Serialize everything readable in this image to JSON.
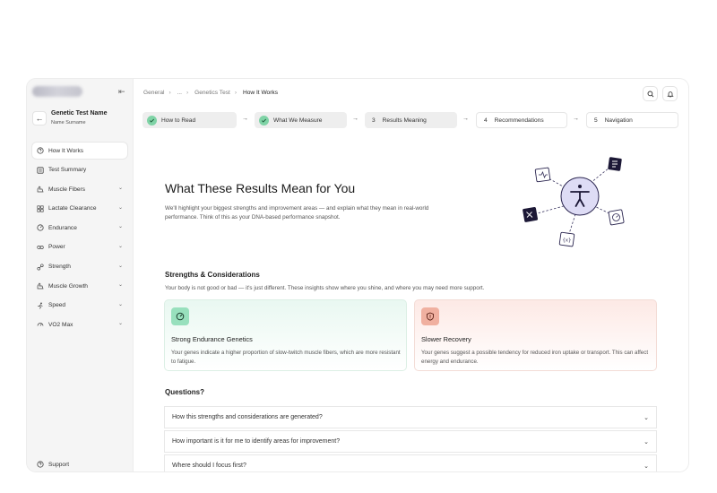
{
  "sidebar": {
    "user": {
      "name": "Genetic Test Name",
      "subtitle": "Name Surname"
    },
    "items": [
      {
        "label": "How It Works",
        "icon": "book-icon",
        "active": true,
        "expandable": false
      },
      {
        "label": "Test Summary",
        "icon": "summary-icon",
        "active": false,
        "expandable": false
      },
      {
        "label": "Muscle Fibers",
        "icon": "muscle-icon",
        "active": false,
        "expandable": true
      },
      {
        "label": "Lactate Clearance",
        "icon": "lactate-icon",
        "active": false,
        "expandable": true
      },
      {
        "label": "Endurance",
        "icon": "endurance-icon",
        "active": false,
        "expandable": true
      },
      {
        "label": "Power",
        "icon": "power-icon",
        "active": false,
        "expandable": true
      },
      {
        "label": "Strength",
        "icon": "strength-icon",
        "active": false,
        "expandable": true
      },
      {
        "label": "Muscle Growth",
        "icon": "growth-icon",
        "active": false,
        "expandable": true
      },
      {
        "label": "Speed",
        "icon": "speed-icon",
        "active": false,
        "expandable": true
      },
      {
        "label": "VO2 Max",
        "icon": "vo2-icon",
        "active": false,
        "expandable": true
      }
    ],
    "support_label": "Support"
  },
  "breadcrumb": [
    "General",
    "...",
    "Genetics Test",
    "How It Works"
  ],
  "steps": [
    {
      "label": "How to Read",
      "status": "done"
    },
    {
      "label": "What We Measure",
      "status": "done"
    },
    {
      "number": "3",
      "label": "Results Meaning",
      "status": "current"
    },
    {
      "number": "4",
      "label": "Recommendations",
      "status": "todo"
    },
    {
      "number": "5",
      "label": "Navigation",
      "status": "todo"
    }
  ],
  "hero": {
    "title": "What These Results Mean for You",
    "description": "We'll highlight your biggest strengths and improvement areas — and explain what they mean in real-world performance. Think of this as your DNA-based performance snapshot."
  },
  "strengths": {
    "title": "Strengths & Considerations",
    "description": "Your body is not good or bad — it's just different. These insights show where you shine, and where you may need more support.",
    "cards": [
      {
        "title": "Strong Endurance Genetics",
        "body": "Your genes indicate a higher proportion of slow-twitch muscle fibers, which are more resistant to fatigue.",
        "tone": "green",
        "icon": "gauge-icon"
      },
      {
        "title": "Slower Recovery",
        "body": "Your genes suggest a possible tendency for reduced iron uptake or transport. This can affect energy and endurance.",
        "tone": "red",
        "icon": "shield-alert-icon"
      }
    ]
  },
  "questions": {
    "title": "Questions?",
    "items": [
      "How this strengths and considerations are generated?",
      "How important is it for me to identify areas for improvement?",
      "Where should I focus first?"
    ]
  },
  "colors": {
    "accent_green": "#7fd3a6",
    "accent_red": "#f0b0a0",
    "illustration_dark": "#1c1836",
    "illustration_light": "#dedcf5"
  }
}
